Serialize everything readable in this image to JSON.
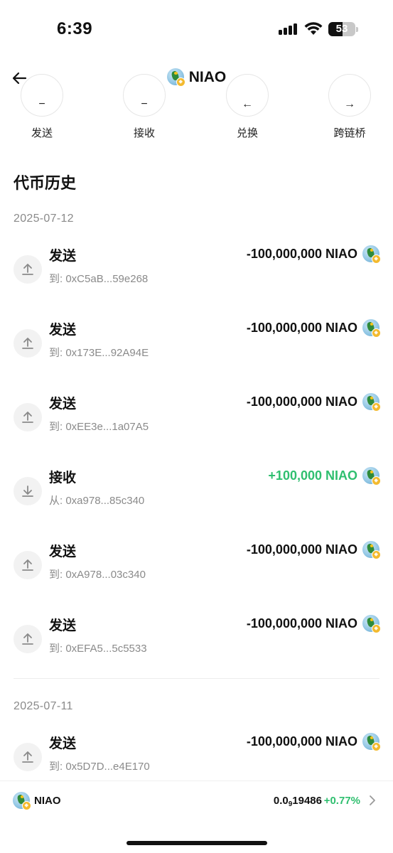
{
  "status_bar": {
    "time": "6:39",
    "battery": "53",
    "battery_level": 0.53
  },
  "header": {
    "title": "NIAO"
  },
  "actions": [
    {
      "label": "发送",
      "icon": "send-icon",
      "glyph": "−"
    },
    {
      "label": "接收",
      "icon": "receive-icon",
      "glyph": "−"
    },
    {
      "label": "兑换",
      "icon": "swap-icon",
      "glyph": "←"
    },
    {
      "label": "跨链桥",
      "icon": "bridge-icon",
      "glyph": "→"
    }
  ],
  "history": {
    "title": "代币历史",
    "groups": [
      {
        "date": "2025-07-12",
        "items": [
          {
            "type": "发送",
            "direction": "out",
            "address": "到: 0xC5aB...59e268",
            "amount": "-100,000,000 NIAO"
          },
          {
            "type": "发送",
            "direction": "out",
            "address": "到: 0x173E...92A94E",
            "amount": "-100,000,000 NIAO"
          },
          {
            "type": "发送",
            "direction": "out",
            "address": "到: 0xEE3e...1a07A5",
            "amount": "-100,000,000 NIAO"
          },
          {
            "type": "接收",
            "direction": "in",
            "address": "从: 0xa978...85c340",
            "amount": "+100,000 NIAO"
          },
          {
            "type": "发送",
            "direction": "out",
            "address": "到: 0xA978...03c340",
            "amount": "-100,000,000 NIAO"
          },
          {
            "type": "发送",
            "direction": "out",
            "address": "到: 0xEFA5...5c5533",
            "amount": "-100,000,000 NIAO"
          }
        ]
      },
      {
        "date": "2025-07-11",
        "items": [
          {
            "type": "发送",
            "direction": "out",
            "address": "到: 0x5D7D...e4E170",
            "amount": "-100,000,000 NIAO"
          }
        ]
      }
    ]
  },
  "price_bar": {
    "symbol": "NIAO",
    "price_prefix": "0.0",
    "price_zeros": "9",
    "price_digits": "19486",
    "change": "+0.77%"
  },
  "colors": {
    "positive": "#2fbf6f",
    "muted": "#8a8a8a"
  }
}
